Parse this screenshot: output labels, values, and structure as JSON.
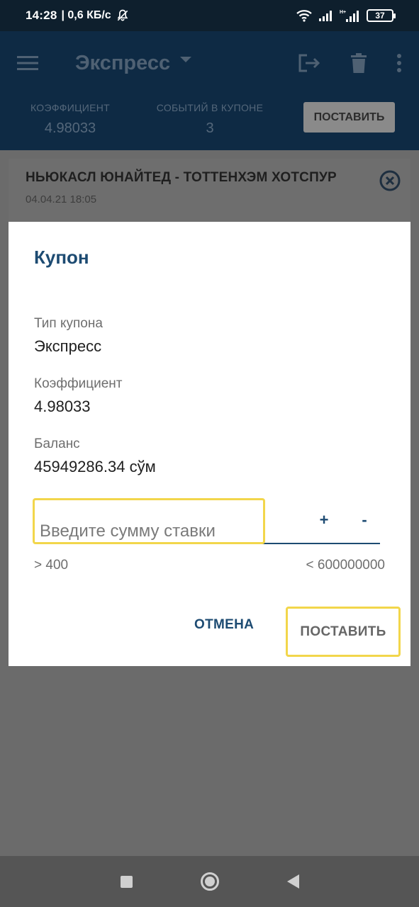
{
  "status_bar": {
    "time": "14:28",
    "network_speed": "| 0,6 КБ/с",
    "battery_level": "37"
  },
  "toolbar": {
    "title": "Экспресс",
    "icons": [
      "menu-icon",
      "caret-down-icon",
      "logout-icon",
      "trash-icon",
      "more-vert-icon"
    ]
  },
  "summary": {
    "odds_label": "КОЭФФИЦИЕНТ",
    "odds_value": "4.98033",
    "events_label": "СОБЫТИЙ В КУПОНЕ",
    "events_value": "3",
    "place_button": "ПОСТАВИТЬ"
  },
  "event_card": {
    "teams": "НЬЮКАСЛ ЮНАЙТЕД - ТОТТЕНХЭМ ХОТСПУР",
    "datetime": "04.04.21 18:05"
  },
  "dialog": {
    "title": "Купон",
    "coupon_type_label": "Тип купона",
    "coupon_type_value": "Экспресс",
    "odds_label": "Коэффициент",
    "odds_value": "4.98033",
    "balance_label": "Баланс",
    "balance_value": "45949286.34 сўм",
    "stake_placeholder": "Введите сумму ставки",
    "stake_value": "",
    "plus_label": "+",
    "minus_label": "-",
    "min_limit": "> 400",
    "max_limit": "< 600000000",
    "cancel_button": "ОТМЕНА",
    "place_button": "ПОСТАВИТЬ"
  },
  "colors": {
    "primary": "#0e2a44",
    "accent_text": "#1d4b72",
    "highlight": "#f2d64b"
  }
}
